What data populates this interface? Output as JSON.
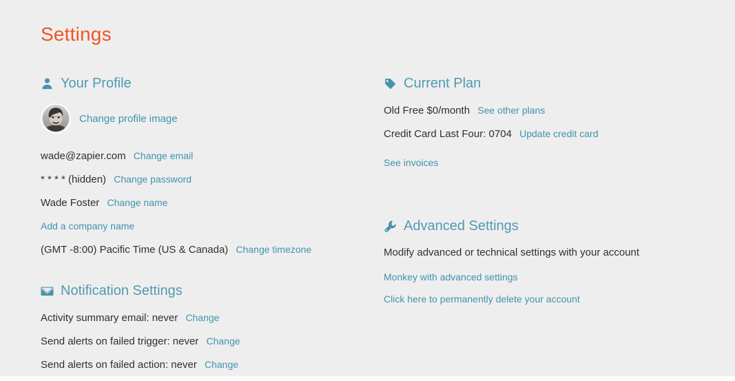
{
  "page": {
    "title": "Settings",
    "title_color": "#f05423",
    "heading_color": "#4e9bb3",
    "link_color": "#3f93ad",
    "text_color": "#2f2f2f",
    "background_color": "#efeeee"
  },
  "profile": {
    "heading": "Your Profile",
    "heading_icon": "user-icon",
    "avatar_alt": "avatar",
    "change_image_link": "Change profile image",
    "email": "wade@zapier.com",
    "change_email_link": "Change email",
    "password": "* * * * (hidden)",
    "change_password_link": "Change password",
    "name": "Wade Foster",
    "change_name_link": "Change name",
    "add_company_link": "Add a company name",
    "timezone": "(GMT -8:00) Pacific Time (US & Canada)",
    "change_timezone_link": "Change timezone"
  },
  "notifications": {
    "heading": "Notification Settings",
    "heading_icon": "envelope-icon",
    "items": [
      {
        "label": "Activity summary email: never",
        "link": "Change"
      },
      {
        "label": "Send alerts on failed trigger: never",
        "link": "Change"
      },
      {
        "label": "Send alerts on failed action: never",
        "link": "Change"
      }
    ]
  },
  "plan": {
    "heading": "Current Plan",
    "heading_icon": "tag-icon",
    "plan_name": "Old Free $0/month",
    "see_other_plans_link": "See other plans",
    "credit_card": "Credit Card Last Four: 0704",
    "update_card_link": "Update credit card",
    "see_invoices_link": "See invoices"
  },
  "advanced": {
    "heading": "Advanced Settings",
    "heading_icon": "wrench-icon",
    "description": "Modify advanced or technical settings with your account",
    "monkey_link": "Monkey with advanced settings",
    "delete_link": "Click here to permanently delete your account"
  }
}
